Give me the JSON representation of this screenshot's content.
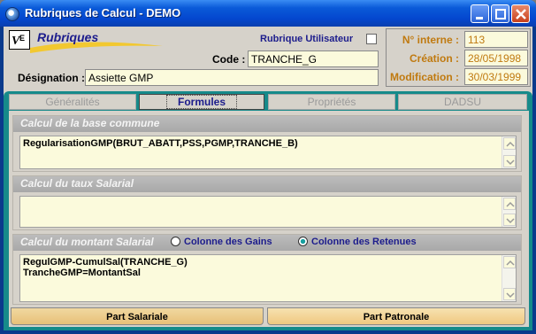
{
  "window": {
    "title": "Rubriques de Calcul - DEMO"
  },
  "header": {
    "logo_title": "Rubriques",
    "rubrique_utilisateur_label": "Rubrique Utilisateur",
    "rubrique_utilisateur_checked": false,
    "code_label": "Code :",
    "code_value": "TRANCHE_G",
    "designation_label": "Désignation :",
    "designation_value": "Assiette GMP"
  },
  "info": {
    "numero_interne_label": "N° interne :",
    "numero_interne_value": "113",
    "creation_label": "Création :",
    "creation_value": "28/05/1998",
    "modification_label": "Modification :",
    "modification_value": "30/03/1999"
  },
  "tabs": [
    {
      "label": "Généralités",
      "active": false
    },
    {
      "label": "Formules",
      "active": true
    },
    {
      "label": "Propriétés",
      "active": false
    },
    {
      "label": "DADSU",
      "active": false
    }
  ],
  "formules": {
    "base_commune": {
      "title": "Calcul de la base commune",
      "formula": "RegularisationGMP(BRUT_ABATT,PSS,PGMP,TRANCHE_B)"
    },
    "taux_salarial": {
      "title": "Calcul du taux Salarial",
      "formula": ""
    },
    "montant_salarial": {
      "title": "Calcul du montant Salarial",
      "radio_gains_label": "Colonne des Gains",
      "radio_retenues_label": "Colonne des Retenues",
      "selected": "retenues",
      "formula_line1": "RegulGMP-CumulSal(TRANCHE_G)",
      "formula_line2": "TrancheGMP=MontantSal"
    }
  },
  "bottom_tabs": {
    "salariale": "Part Salariale",
    "patronale": "Part Patronale"
  },
  "colors": {
    "titlebar": "#0a5ad8",
    "tab_area": "#168a8a",
    "field_bg": "#fbfadc",
    "label_orange": "#c07a10",
    "label_navy": "#1c1c8c"
  }
}
